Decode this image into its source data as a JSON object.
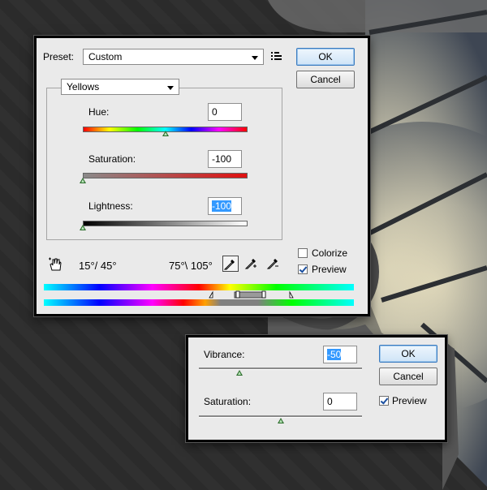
{
  "hue_saturation": {
    "preset_label": "Preset:",
    "preset_value": "Custom",
    "ok_label": "OK",
    "cancel_label": "Cancel",
    "channel_value": "Yellows",
    "hue_label": "Hue:",
    "hue_value": "0",
    "hue_fraction": 0.5,
    "saturation_label": "Saturation:",
    "saturation_value": "-100",
    "saturation_fraction": 0.0,
    "lightness_label": "Lightness:",
    "lightness_value": "-100",
    "lightness_fraction": 0.0,
    "range_left": "15°/ 45°",
    "range_right": "75°\\ 105°",
    "colorize_label": "Colorize",
    "colorize_checked": false,
    "preview_label": "Preview",
    "preview_checked": true
  },
  "vibrance": {
    "vibrance_label": "Vibrance:",
    "vibrance_value": "-50",
    "vibrance_fraction": 0.25,
    "saturation_label": "Saturation:",
    "saturation_value": "0",
    "saturation_fraction": 0.5,
    "ok_label": "OK",
    "cancel_label": "Cancel",
    "preview_label": "Preview",
    "preview_checked": true
  }
}
